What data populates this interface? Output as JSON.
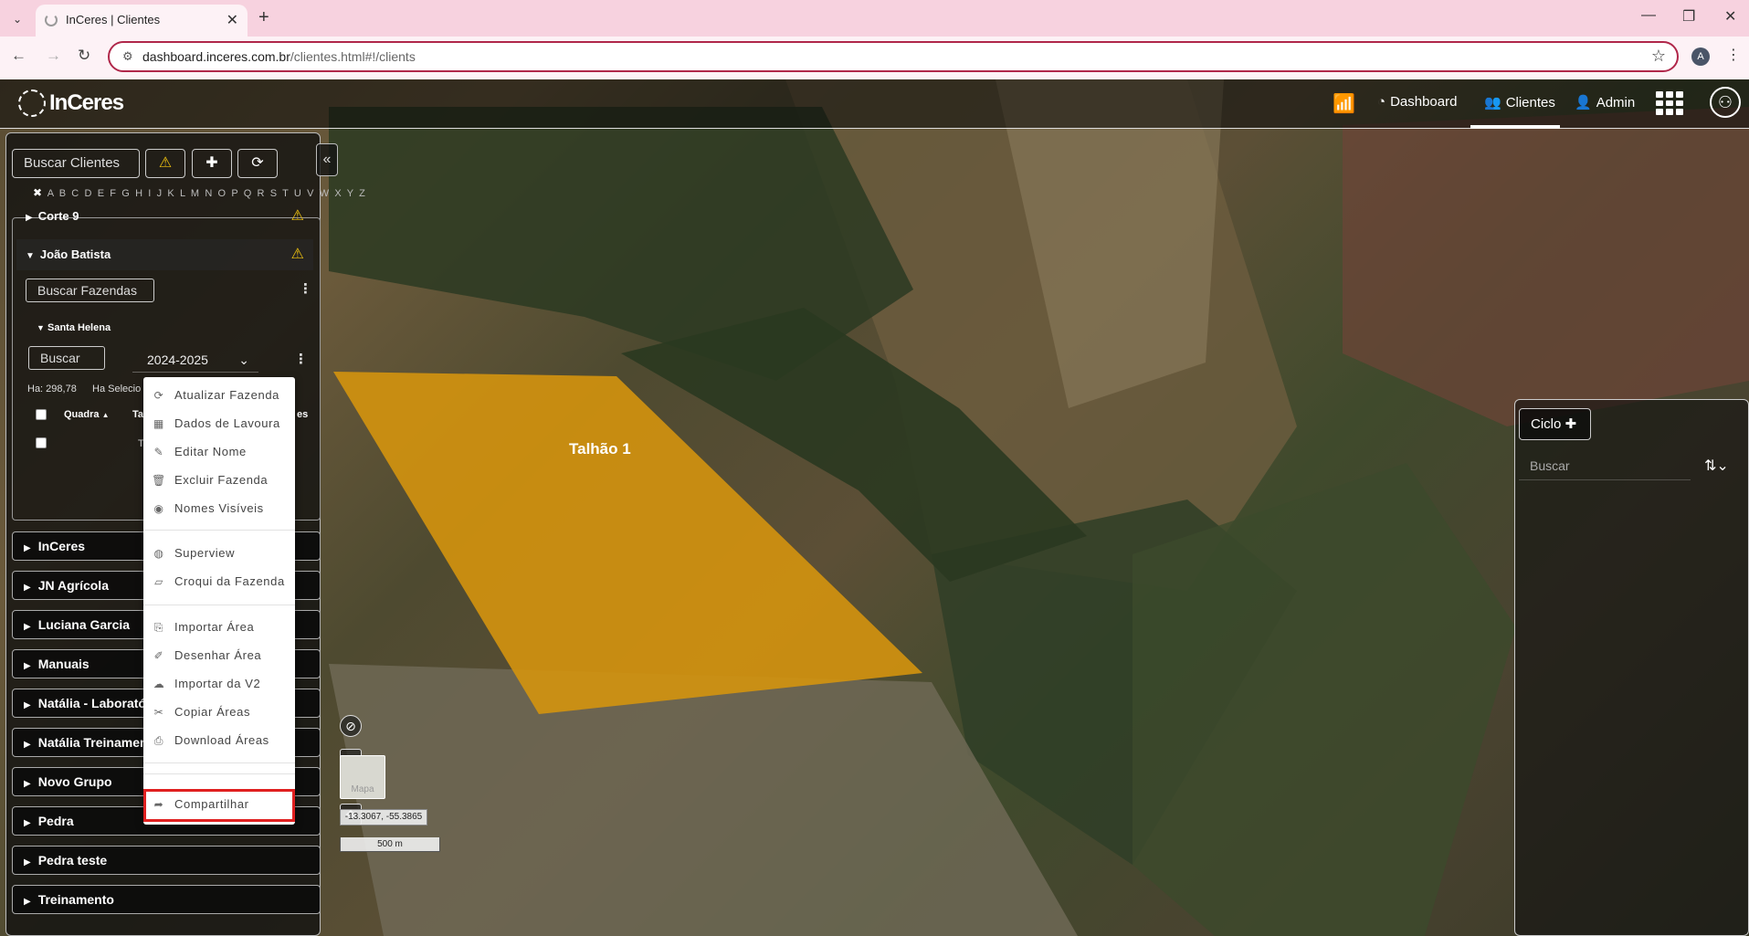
{
  "browser": {
    "tab_title": "InCeres | Clientes",
    "url_host": "dashboard.inceres.com.br",
    "url_path": "/clientes.html#!/clients",
    "profile_initial": "A"
  },
  "app": {
    "logo": "InCeres",
    "nav": [
      {
        "label": "Dashboard",
        "icon": "dashboard-icon"
      },
      {
        "label": "Clientes",
        "icon": "users-icon",
        "active": true
      },
      {
        "label": "Admin",
        "icon": "user-plus-icon"
      }
    ]
  },
  "sidebar": {
    "search_placeholder": "Buscar Clientes",
    "alphabet": "A B C D E F G H I J K L M N O P Q R S T U V W X Y Z",
    "clients_top": [
      {
        "name": "Corte 9",
        "warning": true
      },
      {
        "name": "João Batista",
        "warning": true,
        "expanded": true
      }
    ],
    "farms_search": "Buscar Fazendas",
    "farm": "Santa Helena",
    "areas_search": "Buscar",
    "season": "2024-2025",
    "ha_total": "Ha: 298,78",
    "ha_selected": "Ha Selecio",
    "col_quadra": "Quadra",
    "col_t": "Ta",
    "col_es": "es",
    "row_t": "T",
    "groups": [
      "InCeres",
      "JN Agrícola",
      "Luciana Garcia",
      "Manuais",
      "Natália - Laborató",
      "Natália Treinamen",
      "Novo Grupo",
      "Pedra",
      "Pedra teste",
      "Treinamento"
    ]
  },
  "context_menu": {
    "items": [
      {
        "label": "Atualizar Fazenda",
        "icon": "refresh-icon"
      },
      {
        "label": "Dados de Lavoura",
        "icon": "table-icon"
      },
      {
        "label": "Editar Nome",
        "icon": "pencil-icon"
      },
      {
        "label": "Excluir Fazenda",
        "icon": "trash-icon"
      },
      {
        "label": "Nomes Visíveis",
        "icon": "eye-icon"
      },
      {
        "label": "Superview",
        "icon": "compass-icon"
      },
      {
        "label": "Croqui da Fazenda",
        "icon": "map-icon"
      },
      {
        "label": "Importar Área",
        "icon": "file-import-icon"
      },
      {
        "label": "Desenhar Área",
        "icon": "paintbrush-icon"
      },
      {
        "label": "Importar da V2",
        "icon": "cloud-download-icon"
      },
      {
        "label": "Copiar Áreas",
        "icon": "scissors-icon"
      },
      {
        "label": "Download Áreas",
        "icon": "file-download-icon"
      },
      {
        "label": "Compartilhar",
        "icon": "share-icon",
        "highlighted": true
      }
    ],
    "highlight_color": "#e02020"
  },
  "map": {
    "field_label": "Talhão 1",
    "field_color": "#d4930e",
    "layer_thumb": "Mapa",
    "coords": "-13.3067, -55.3865",
    "scale": "500 m"
  },
  "right_panel": {
    "ciclo_label": "Ciclo",
    "search_placeholder": "Buscar"
  }
}
